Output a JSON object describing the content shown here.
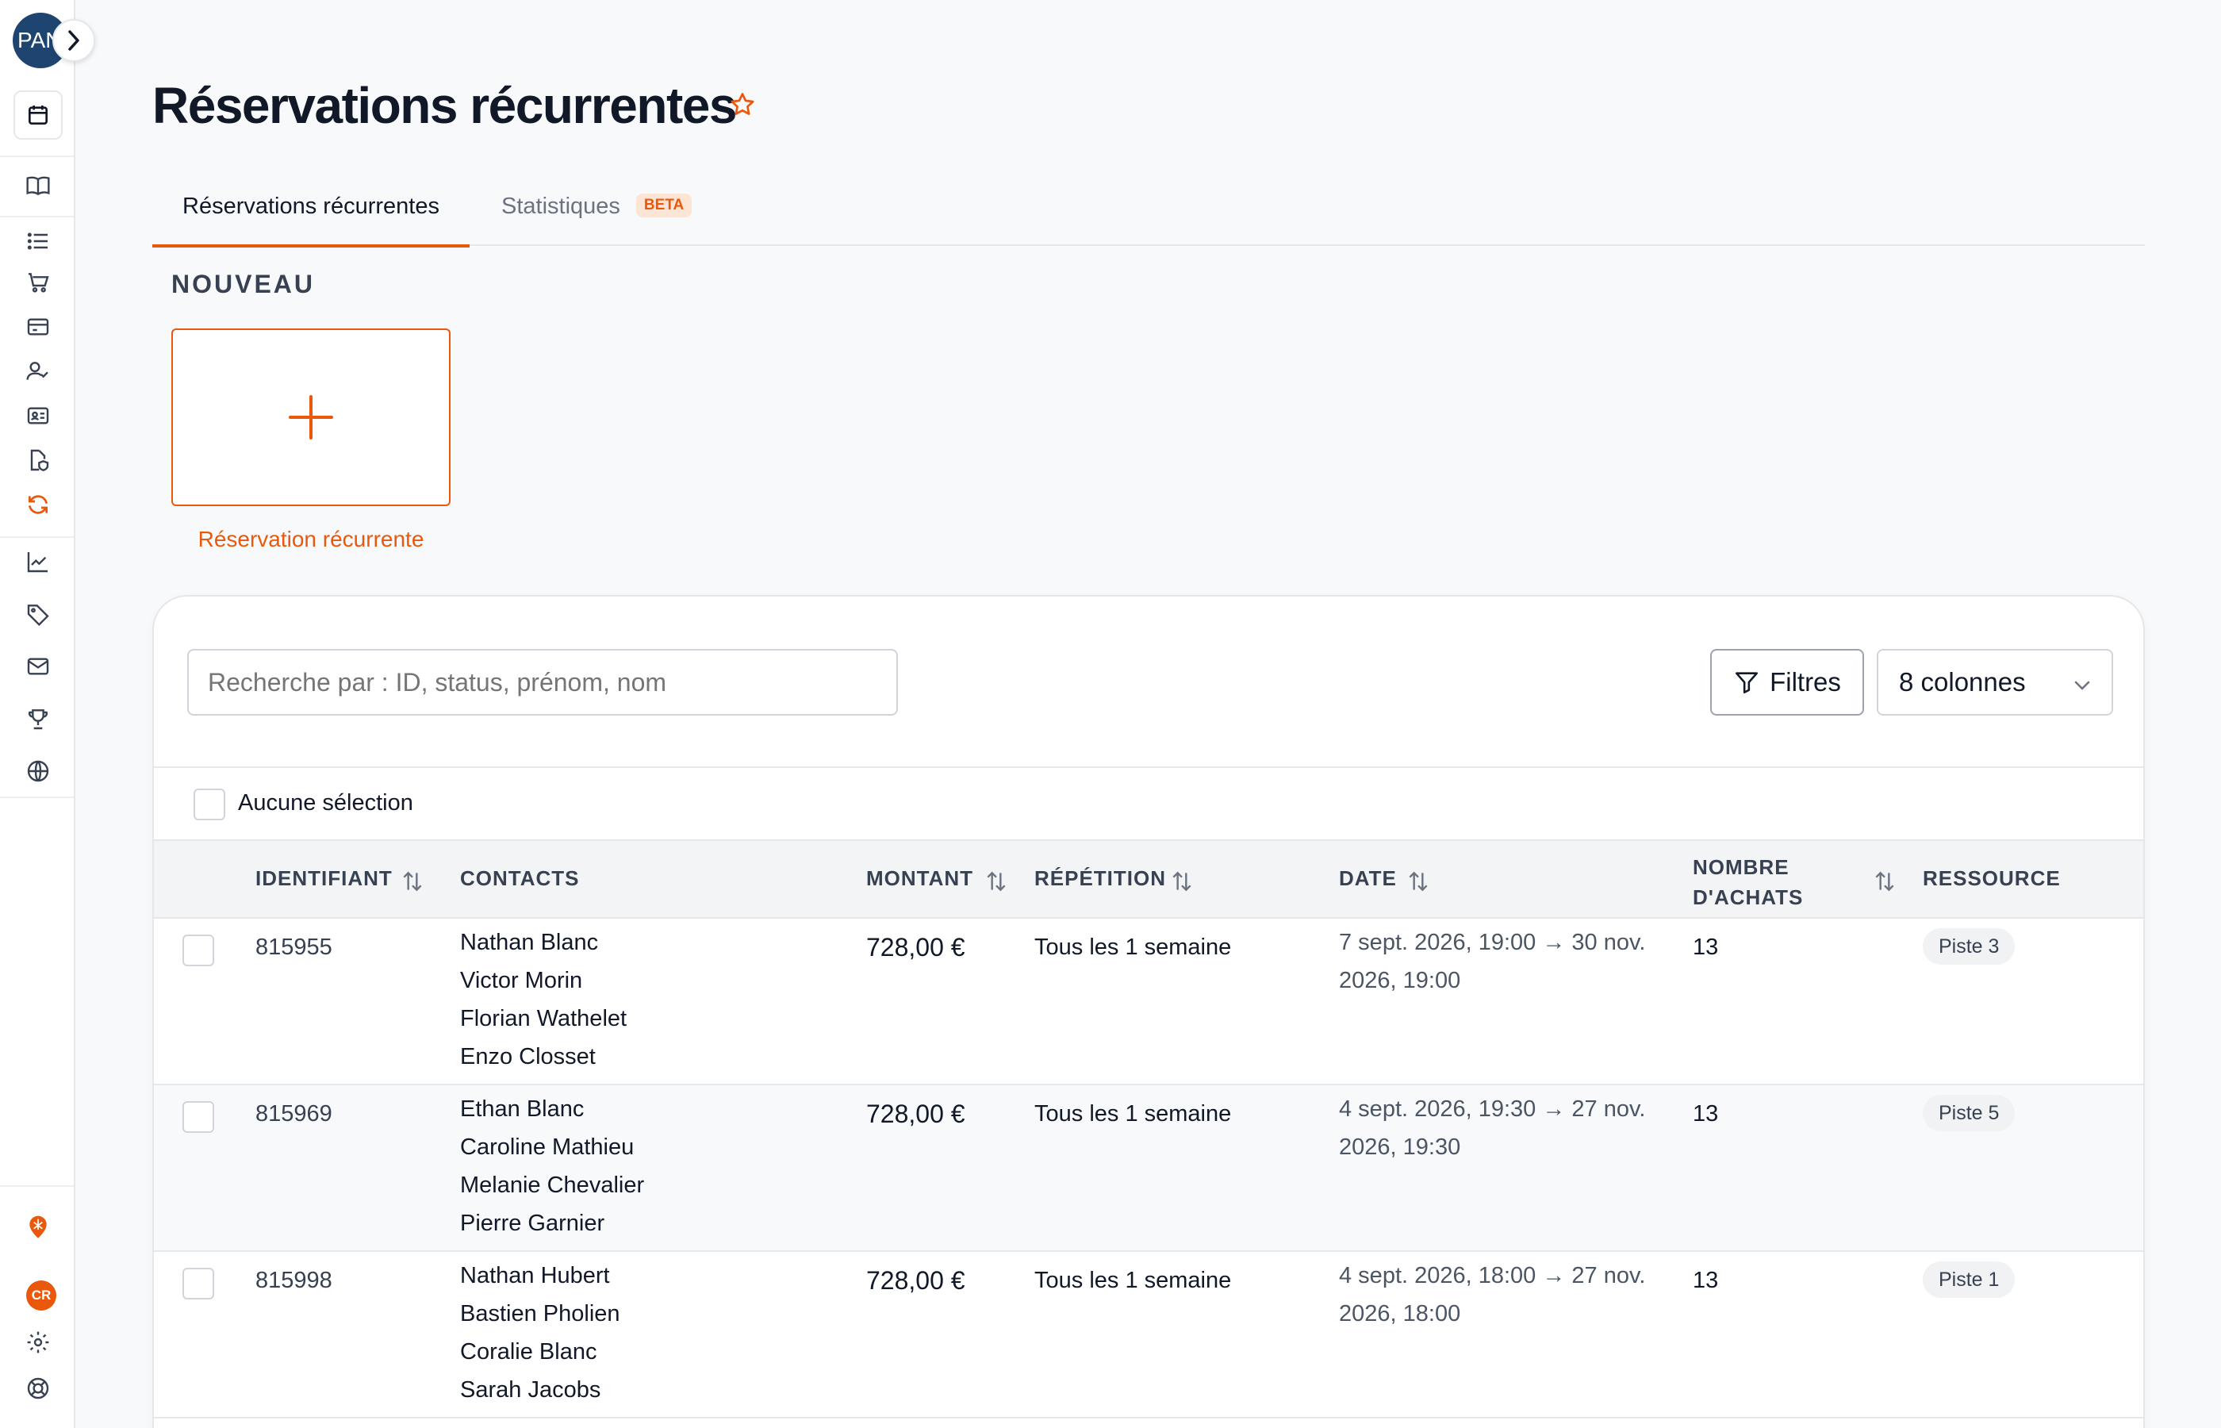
{
  "user": {
    "initials": "PAN",
    "app_badge": "CR"
  },
  "page": {
    "title": "Réservations récurrentes"
  },
  "tabs": [
    {
      "label": "Réservations récurrentes"
    },
    {
      "label": "Statistiques",
      "badge": "BETA"
    }
  ],
  "new_section": {
    "title": "NOUVEAU",
    "card_label": "Réservation récurrente"
  },
  "toolbar": {
    "search_placeholder": "Recherche par : ID, status, prénom, nom",
    "filters_label": "Filtres",
    "columns_label": "8 colonnes"
  },
  "selection": {
    "label": "Aucune sélection"
  },
  "table": {
    "headers": {
      "id": "IDENTIFIANT",
      "contacts": "CONTACTS",
      "amount": "MONTANT",
      "repeat": "RÉPÉTITION",
      "date": "DATE",
      "purchases_1": "NOMBRE",
      "purchases_2": "D'ACHATS",
      "resource": "RESSOURCE"
    },
    "rows": [
      {
        "id": "815955",
        "contacts": [
          "Nathan Blanc",
          "Victor Morin",
          "Florian Wathelet",
          "Enzo Closset"
        ],
        "amount": "728,00 €",
        "repeat": "Tous les 1 semaine",
        "date_1": "7 sept. 2026, 19:00 → 30 nov.",
        "date_2": "2026, 19:00",
        "purchases": "13",
        "resource": "Piste 3"
      },
      {
        "id": "815969",
        "contacts": [
          "Ethan Blanc",
          "Caroline Mathieu",
          "Melanie Chevalier",
          "Pierre Garnier"
        ],
        "amount": "728,00 €",
        "repeat": "Tous les 1 semaine",
        "date_1": "4 sept. 2026, 19:30 → 27 nov.",
        "date_2": "2026, 19:30",
        "purchases": "13",
        "resource": "Piste 5"
      },
      {
        "id": "815998",
        "contacts": [
          "Nathan Hubert",
          "Bastien Pholien",
          "Coralie Blanc",
          "Sarah Jacobs"
        ],
        "amount": "728,00 €",
        "repeat": "Tous les 1 semaine",
        "date_1": "4 sept. 2026, 18:00 → 27 nov.",
        "date_2": "2026, 18:00",
        "purchases": "13",
        "resource": "Piste 1"
      }
    ]
  },
  "colors": {
    "accent": "#ea580c",
    "avatar": "#1e4470",
    "text": "#111827"
  }
}
